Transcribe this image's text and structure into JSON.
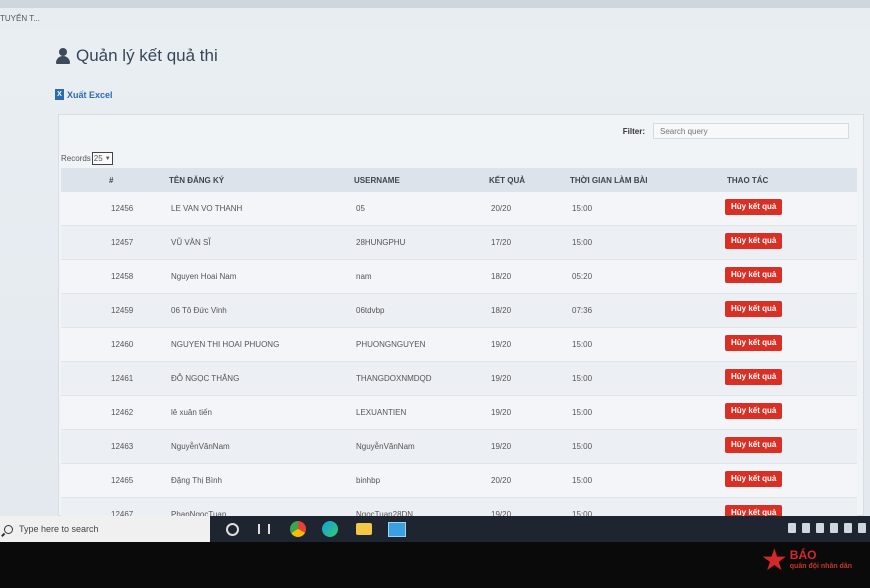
{
  "browser": {
    "tab_text": "TUYỂN T..."
  },
  "page": {
    "title": "Quản lý kết quả thi",
    "export_label": "Xuất Excel"
  },
  "filter": {
    "label": "Filter:",
    "placeholder": "Search query"
  },
  "records": {
    "label": "Records",
    "value": "25"
  },
  "table": {
    "headers": [
      "#",
      "TÊN ĐĂNG KÝ",
      "USERNAME",
      "KẾT QUẢ",
      "THỜI GIAN LÀM BÀI",
      "THAO TÁC"
    ],
    "rows": [
      {
        "id": "12456",
        "name": "LE VAN VO THANH",
        "username": "05",
        "score": "20/20",
        "time": "15:00",
        "action": "Hủy kết quả"
      },
      {
        "id": "12457",
        "name": "VŨ VĂN SĨ",
        "username": "28HUNGPHU",
        "score": "17/20",
        "time": "15:00",
        "action": "Hủy kết quả"
      },
      {
        "id": "12458",
        "name": "Nguyen Hoai Nam",
        "username": "nam",
        "score": "18/20",
        "time": "05:20",
        "action": "Hủy kết quả"
      },
      {
        "id": "12459",
        "name": "06 Tô Đức Vinh",
        "username": "06tdvbp",
        "score": "18/20",
        "time": "07:36",
        "action": "Hủy kết quả"
      },
      {
        "id": "12460",
        "name": "NGUYEN THI HOAI PHUONG",
        "username": "PHUONGNGUYEN",
        "score": "19/20",
        "time": "15:00",
        "action": "Hủy kết quả"
      },
      {
        "id": "12461",
        "name": "ĐỖ NGỌC THẮNG",
        "username": "THANGDOXNMDQD",
        "score": "19/20",
        "time": "15:00",
        "action": "Hủy kết quả"
      },
      {
        "id": "12462",
        "name": "lê xuân tiến",
        "username": "LEXUANTIEN",
        "score": "19/20",
        "time": "15:00",
        "action": "Hủy kết quả"
      },
      {
        "id": "12463",
        "name": "NguyễnVănNam",
        "username": "NguyễnVănNam",
        "score": "19/20",
        "time": "15:00",
        "action": "Hủy kết quả"
      },
      {
        "id": "12465",
        "name": "Đặng Thị Bình",
        "username": "binhbp",
        "score": "20/20",
        "time": "15:00",
        "action": "Hủy kết quả"
      },
      {
        "id": "12467",
        "name": "PhanNgocTuan",
        "username": "NgocTuan28DN",
        "score": "19/20",
        "time": "15:00",
        "action": "Hủy kết quả"
      }
    ]
  },
  "taskbar": {
    "search_placeholder": "Type here to search"
  },
  "watermark": {
    "line1": "BÁO",
    "line2": "quân đội nhân dân"
  },
  "colors": {
    "cancel_button": "#d93025",
    "link": "#2b6cb0",
    "taskbar": "#1e2530"
  }
}
